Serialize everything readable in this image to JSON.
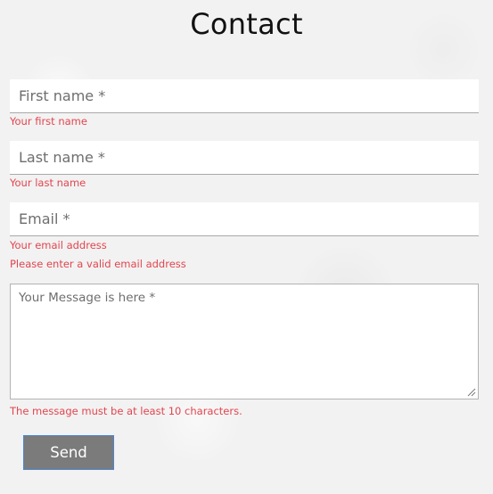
{
  "page_title": "Contact",
  "form": {
    "first_name": {
      "placeholder": "First name *",
      "value": "",
      "error": "Your first name"
    },
    "last_name": {
      "placeholder": "Last name *",
      "value": "",
      "error": "Your last name"
    },
    "email": {
      "placeholder": "Email *",
      "value": "",
      "error": "Your email address",
      "error_2": "Please enter a valid email address"
    },
    "message": {
      "placeholder": "Your Message is here *",
      "value": "",
      "error": "The message must be at least 10 characters."
    },
    "send_label": "Send"
  },
  "colors": {
    "error_text": "#e2454f",
    "button_bg": "#7b7b7b",
    "button_border": "#4a86d6",
    "background": "#f2f2f2"
  }
}
